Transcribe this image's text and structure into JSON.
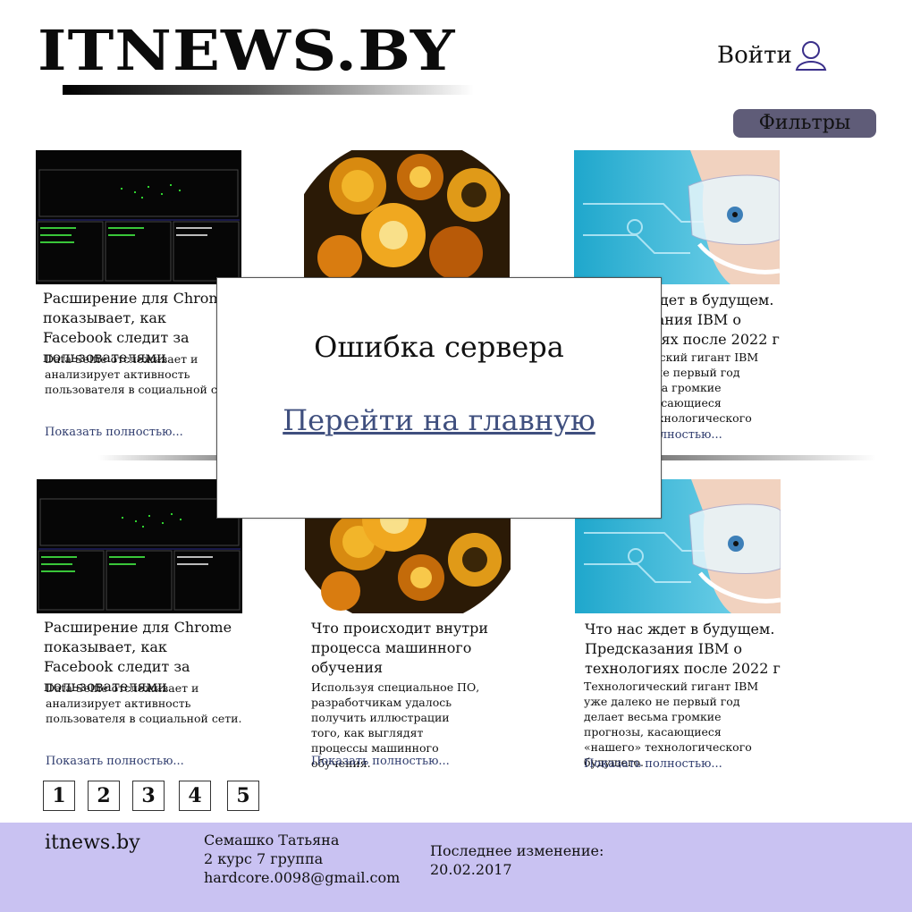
{
  "header": {
    "logo": "ITNEWS.BY",
    "login_label": "Войти",
    "filters_label": "Фильтры"
  },
  "cards": [
    {
      "title": "Расширение для Chrome показывает, как Facebook следит за пользователями",
      "description": "Data Selfie отслеживает и анализирует активность пользователя в социальной сети.",
      "more": "Показать полностью..."
    },
    {
      "title": "",
      "description": "",
      "more": ""
    },
    {
      "title": "Что нас ждет в будущем. Предсказания IBM о технологиях после 2022 г",
      "description": "Технологический гигант IBM уже далеко не первый год делает весьма громкие прогнозы, касающиеся «нашего» технологического будущего.",
      "more": "Показать полностью..."
    },
    {
      "title": "Расширение для Chrome показывает, как Facebook следит за пользователями",
      "description": "Data Selfie отслеживает и анализирует активность пользователя в социальной сети.",
      "more": "Показать полностью..."
    },
    {
      "title": "Что происходит внутри процесса машинного обучения",
      "description": "Используя специальное ПО, разработчикам удалось получить иллюстрации того, как выглядят процессы машинного обучения.",
      "more": "Показать полностью..."
    },
    {
      "title": "Что нас ждет в будущем. Предсказания IBM о технологиях после 2022 г",
      "description": "Технологический гигант IBM уже далеко не первый год делает весьма громкие прогнозы, касающиеся «нашего» технологического будущего.",
      "more": "Показать полностью..."
    }
  ],
  "pagination": [
    "1",
    "2",
    "3",
    "4",
    "5"
  ],
  "modal": {
    "title": "Ошибка сервера",
    "link": "Перейти на главную"
  },
  "footer": {
    "site": "itnews.by",
    "author_lines": [
      "Семашко Татьяна",
      "2 курс 7 группа",
      "hardcore.0098@gmail.com"
    ],
    "updated_label": "Последнее изменение:",
    "updated_date": "20.02.2017"
  },
  "colors": {
    "filters_bg": "#5f5c78",
    "footer_bg": "#c9c2f2",
    "link": "#2f3c6e",
    "login_icon": "#3a2f8a"
  },
  "icons": {
    "login": "user-icon"
  }
}
